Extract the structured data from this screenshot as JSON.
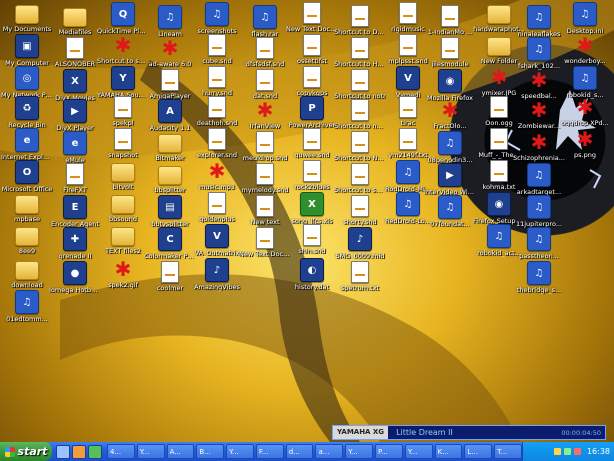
{
  "desktop": {
    "icons": [
      {
        "label": "My Documents",
        "kind": "folder",
        "glyph": ""
      },
      {
        "label": "My Computer",
        "kind": "app",
        "glyph": "▣"
      },
      {
        "label": "My Network Places",
        "kind": "blue",
        "glyph": "◎"
      },
      {
        "label": "Recycle Bin",
        "kind": "app",
        "glyph": "♻"
      },
      {
        "label": "Internet Explorer",
        "kind": "blue",
        "glyph": "e"
      },
      {
        "label": "Microsoft Office",
        "kind": "app",
        "glyph": "O"
      },
      {
        "label": "mpbase",
        "kind": "folder",
        "glyph": ""
      },
      {
        "label": "8ee9",
        "kind": "folder",
        "glyph": ""
      },
      {
        "label": "download",
        "kind": "folder",
        "glyph": ""
      },
      {
        "label": "01edtomm...",
        "kind": "blue",
        "glyph": "♫"
      },
      {
        "label": "Mediafiles",
        "kind": "folder",
        "glyph": ""
      },
      {
        "label": "ALSONOBER",
        "kind": "doc",
        "glyph": ""
      },
      {
        "label": "DivX Movies",
        "kind": "app",
        "glyph": "X"
      },
      {
        "label": "DivX Player",
        "kind": "app",
        "glyph": "▶"
      },
      {
        "label": "eMule",
        "kind": "blue",
        "glyph": "e"
      },
      {
        "label": "FireFXT",
        "kind": "doc",
        "glyph": ""
      },
      {
        "label": "Encoder Agent",
        "kind": "app",
        "glyph": "E"
      },
      {
        "label": "grenade II",
        "kind": "app",
        "glyph": "✚"
      },
      {
        "label": "Iomega Hotburn",
        "kind": "app",
        "glyph": "●"
      },
      {
        "label": "QuickTime Player",
        "kind": "blue",
        "glyph": "Q"
      },
      {
        "label": "Shortcut to snapped",
        "kind": "red",
        "glyph": "✱"
      },
      {
        "label": "YAMAHA SoundVu",
        "kind": "app",
        "glyph": "Y"
      },
      {
        "label": "spekpl",
        "kind": "doc",
        "glyph": ""
      },
      {
        "label": "snapshot",
        "kind": "doc",
        "glyph": ""
      },
      {
        "label": "bitvolt",
        "kind": "folder",
        "glyph": ""
      },
      {
        "label": "bbsound",
        "kind": "folder",
        "glyph": ""
      },
      {
        "label": "TEXT files2",
        "kind": "folder",
        "glyph": ""
      },
      {
        "label": "spek2.gif",
        "kind": "red",
        "glyph": "✱"
      },
      {
        "label": "Lineam",
        "kind": "blue",
        "glyph": "♫"
      },
      {
        "label": "ad-aware 6.0",
        "kind": "red",
        "glyph": "✱"
      },
      {
        "label": "AmigaPlayer",
        "kind": "doc",
        "glyph": ""
      },
      {
        "label": "Audacity 1.1",
        "kind": "app",
        "glyph": "A"
      },
      {
        "label": "Bitmaker",
        "kind": "folder",
        "glyph": ""
      },
      {
        "label": "bbsplitter",
        "kind": "folder",
        "glyph": ""
      },
      {
        "label": "bbtvsplitter",
        "kind": "app",
        "glyph": "▤"
      },
      {
        "label": "Colormaker Photo Editor",
        "kind": "app",
        "glyph": "C"
      },
      {
        "label": "coolmer",
        "kind": "doc",
        "glyph": ""
      },
      {
        "label": "screenshots",
        "kind": "blue",
        "glyph": "♫"
      },
      {
        "label": "cube.snd",
        "kind": "doc",
        "glyph": ""
      },
      {
        "label": "hurry.snd",
        "kind": "doc",
        "glyph": ""
      },
      {
        "label": "deathoh.snd",
        "kind": "doc",
        "glyph": ""
      },
      {
        "label": "explorer.snd",
        "kind": "doc",
        "glyph": ""
      },
      {
        "label": "music.mp3",
        "kind": "red",
        "glyph": "✱"
      },
      {
        "label": "goldenplus",
        "kind": "doc",
        "glyph": ""
      },
      {
        "label": "VA_Outmatrix",
        "kind": "app",
        "glyph": "V"
      },
      {
        "label": "AmazingVibes",
        "kind": "app",
        "glyph": "♪"
      },
      {
        "label": "flash.rar",
        "kind": "blue",
        "glyph": "♫"
      },
      {
        "label": "dfsfsdsf.snd",
        "kind": "doc",
        "glyph": ""
      },
      {
        "label": "dat.snd",
        "kind": "doc",
        "glyph": ""
      },
      {
        "label": "IrfanView",
        "kind": "red",
        "glyph": "✱"
      },
      {
        "label": "meuldrop.snd",
        "kind": "doc",
        "glyph": ""
      },
      {
        "label": "mymelody.snd",
        "kind": "doc",
        "glyph": ""
      },
      {
        "label": "New text",
        "kind": "doc",
        "glyph": ""
      },
      {
        "label": "New Text Docum...",
        "kind": "doc",
        "glyph": ""
      },
      {
        "label": "New Text Docum...",
        "kind": "doc",
        "glyph": ""
      },
      {
        "label": "ossettifst",
        "kind": "doc",
        "glyph": ""
      },
      {
        "label": "copykgps",
        "kind": "doc",
        "glyph": ""
      },
      {
        "label": "PowerArchiver",
        "kind": "app",
        "glyph": "P"
      },
      {
        "label": "quwee.snd",
        "kind": "doc",
        "glyph": ""
      },
      {
        "label": "rock2blues",
        "kind": "doc",
        "glyph": ""
      },
      {
        "label": "song_lfcs.xls",
        "kind": "green",
        "glyph": "X"
      },
      {
        "label": "shin.snd",
        "kind": "doc",
        "glyph": ""
      },
      {
        "label": "history.dat",
        "kind": "app",
        "glyph": "◐"
      },
      {
        "label": "Shortcut to DT99F.exe",
        "kind": "doc",
        "glyph": ""
      },
      {
        "label": "Shortcut to HADIT",
        "kind": "doc",
        "glyph": ""
      },
      {
        "label": "Shortcut to notr",
        "kind": "doc",
        "glyph": ""
      },
      {
        "label": "Shortcut to nmnsdr.exe",
        "kind": "doc",
        "glyph": ""
      },
      {
        "label": "Shortcut to NOTEPAD.EXE",
        "kind": "doc",
        "glyph": ""
      },
      {
        "label": "Shortcut to shorts.exe",
        "kind": "doc",
        "glyph": ""
      },
      {
        "label": "shorty.snd",
        "kind": "doc",
        "glyph": ""
      },
      {
        "label": "SMG_0009.mid",
        "kind": "app",
        "glyph": "♪"
      },
      {
        "label": "spetrum.txt",
        "kind": "doc",
        "glyph": ""
      },
      {
        "label": "rigidmusic",
        "kind": "doc",
        "glyph": ""
      },
      {
        "label": "mplpsst.snd",
        "kind": "doc",
        "glyph": ""
      },
      {
        "label": "Vymedi",
        "kind": "app",
        "glyph": "V"
      },
      {
        "label": "tirac",
        "kind": "doc",
        "glyph": ""
      },
      {
        "label": "ym2149f.txt",
        "kind": "doc",
        "glyph": ""
      },
      {
        "label": "RodDroid-Mi...",
        "kind": "blue",
        "glyph": "♫"
      },
      {
        "label": "RedDroid-Lo...",
        "kind": "blue",
        "glyph": "♫"
      },
      {
        "label": "1-IndianMo ...",
        "kind": "doc",
        "glyph": ""
      },
      {
        "label": "jilesmodule",
        "kind": "doc",
        "glyph": ""
      },
      {
        "label": "Mozilla Firefox",
        "kind": "app",
        "glyph": "◉"
      },
      {
        "label": "FractOlo...",
        "kind": "red",
        "glyph": "✱"
      },
      {
        "label": "08penodin3...",
        "kind": "blue",
        "glyph": "♫"
      },
      {
        "label": "InterVideo WinDVD 6",
        "kind": "app",
        "glyph": "▶"
      },
      {
        "label": "07foundat...",
        "kind": "blue",
        "glyph": "♫"
      },
      {
        "label": "hardwaraphot...",
        "kind": "folder",
        "glyph": ""
      },
      {
        "label": "New Folder",
        "kind": "folder",
        "glyph": ""
      },
      {
        "label": "ymixer.JPG",
        "kind": "red",
        "glyph": "✱"
      },
      {
        "label": "Oon.ogg",
        "kind": "doc",
        "glyph": ""
      },
      {
        "label": "Muff_-_The...",
        "kind": "doc",
        "glyph": ""
      },
      {
        "label": "kohma.txt",
        "kind": "doc",
        "glyph": ""
      },
      {
        "label": "Firefox Setup 1.0.4.exe",
        "kind": "app",
        "glyph": "◉"
      },
      {
        "label": "robokid_act...",
        "kind": "blue",
        "glyph": "♫"
      },
      {
        "label": "ninaleaflakes",
        "kind": "blue",
        "glyph": "♫"
      },
      {
        "label": "fshark_102...",
        "kind": "blue",
        "glyph": "♫"
      },
      {
        "label": "speedbal...",
        "kind": "red",
        "glyph": "✱"
      },
      {
        "label": "Zombiewar...",
        "kind": "red",
        "glyph": "✱"
      },
      {
        "label": "Schizophrenia...",
        "kind": "red",
        "glyph": "✱"
      },
      {
        "label": "arkadtarget...",
        "kind": "blue",
        "glyph": "♫"
      },
      {
        "label": "11jupiterpro...",
        "kind": "blue",
        "glyph": "♫"
      },
      {
        "label": "passtheon...",
        "kind": "blue",
        "glyph": "♫"
      },
      {
        "label": "thebridge_s...",
        "kind": "blue",
        "glyph": "♫"
      },
      {
        "label": "Desktop.ini",
        "kind": "blue",
        "glyph": "♫"
      },
      {
        "label": "wonderboy...",
        "kind": "red",
        "glyph": "✱"
      },
      {
        "label": "robokid_s...",
        "kind": "blue",
        "glyph": "♫"
      },
      {
        "label": "oggdrop XPd...",
        "kind": "red",
        "glyph": "✱"
      },
      {
        "label": "ps.png",
        "kind": "red",
        "glyph": "✱"
      }
    ]
  },
  "player": {
    "brand": "YAMAHA XG",
    "title": "Little Dream II",
    "time": "00:00:04:50"
  },
  "taskbar": {
    "start_label": "start",
    "tasks": [
      "4...",
      "Y...",
      "A...",
      "B...",
      "Y...",
      "F...",
      "d...",
      "a...",
      "Y...",
      "P...",
      "Y...",
      "K...",
      "L...",
      "T..."
    ],
    "clock": "16:38"
  },
  "colors": {
    "taskbar": "#245edb",
    "start": "#3a9a3a",
    "tray": "#0e86e0",
    "icon_label": "#ffffff"
  }
}
